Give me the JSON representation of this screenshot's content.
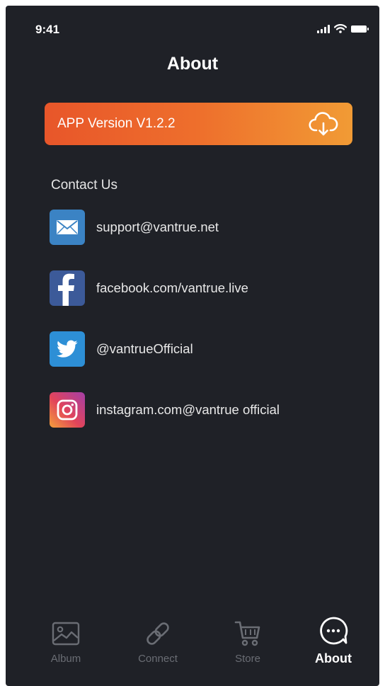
{
  "status_bar": {
    "time": "9:41"
  },
  "header": {
    "title": "About"
  },
  "version_banner": {
    "label": "APP Version V1.2.2",
    "accent_start": "#e8562a",
    "accent_end": "#f19b35",
    "icon": "cloud-download-icon"
  },
  "contact": {
    "heading": "Contact Us",
    "items": [
      {
        "icon": "mail-icon",
        "label": "support@vantrue.net",
        "color": "#3b83c4"
      },
      {
        "icon": "facebook-icon",
        "label": "facebook.com/vantrue.live",
        "color": "#3c5a99"
      },
      {
        "icon": "twitter-icon",
        "label": "@vantrueOfficial",
        "color": "#2d8fd6"
      },
      {
        "icon": "instagram-icon",
        "label": "instagram.com@vantrue official",
        "color": "#e2445a"
      }
    ]
  },
  "tab_bar": {
    "active": "About",
    "tabs": [
      {
        "label": "Album",
        "icon": "image-icon"
      },
      {
        "label": "Connect",
        "icon": "link-icon"
      },
      {
        "label": "Store",
        "icon": "cart-icon"
      },
      {
        "label": "About",
        "icon": "chat-bubble-icon"
      }
    ]
  }
}
